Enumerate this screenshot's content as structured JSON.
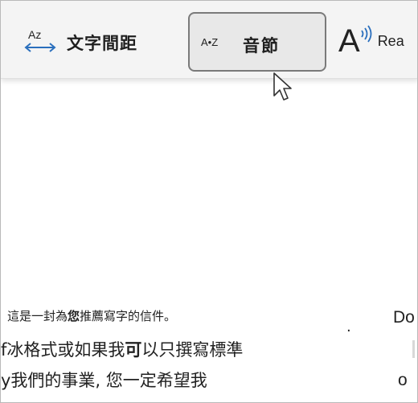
{
  "toolbar": {
    "text_spacing": {
      "icon_text": "Az",
      "label": "文字間距"
    },
    "syllables": {
      "icon_text": "A•Z",
      "label": "音節"
    },
    "read_aloud": {
      "icon_text": "A",
      "label": "Rea"
    }
  },
  "document": {
    "line1_part1": "這是一封為",
    "line1_bold": "您",
    "line1_part2": "推薦寫字的信件。",
    "line2_part1": "f冰格式或如果我",
    "line2_bold": "可",
    "line2_part2": "以只撰寫標準",
    "line3": "y我們的事業, 您一定希望我",
    "right_col_line1": "Do",
    "right_col_line2": "o",
    "stray_mark": "·"
  }
}
